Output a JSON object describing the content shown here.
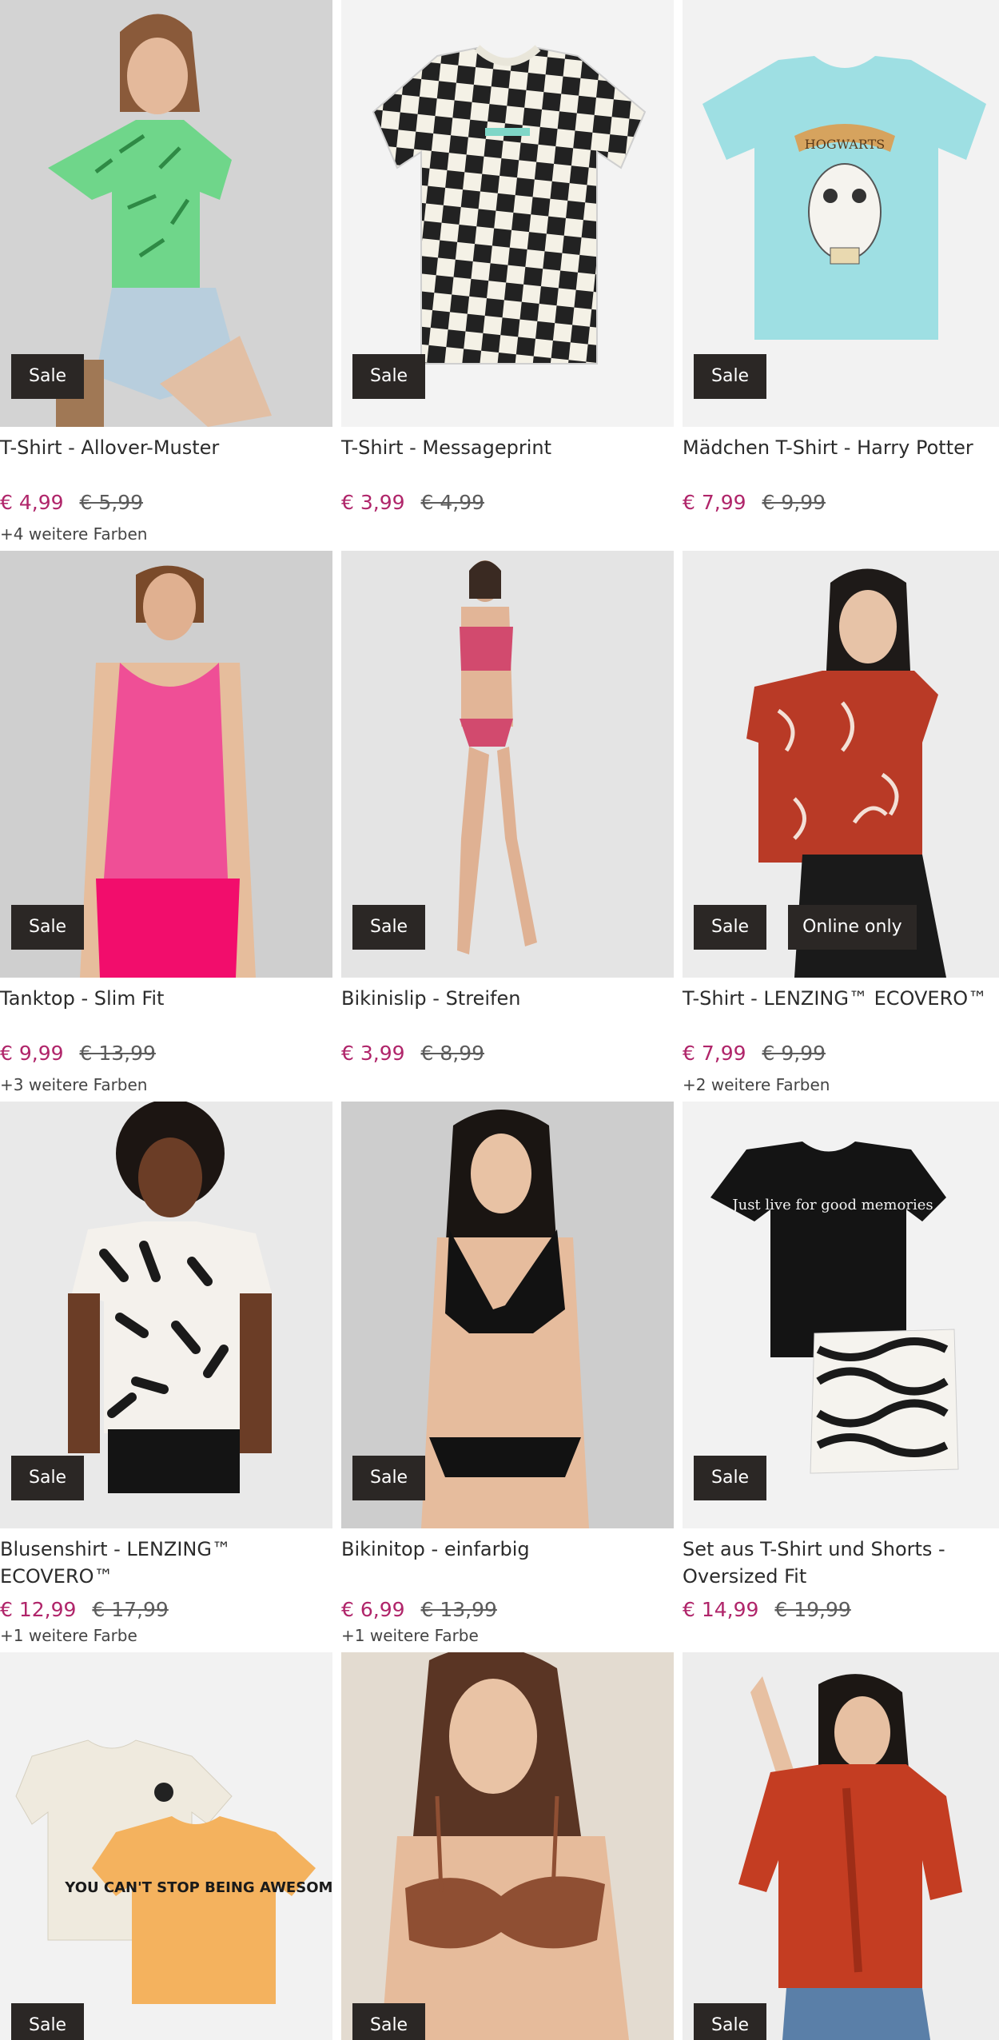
{
  "products": [
    {
      "title": "T-Shirt - Allover-Muster",
      "price_sale": "€ 4,99",
      "price_old": "€ 5,99",
      "colors": "+4 weitere Farben",
      "badge": "Sale",
      "badge2": ""
    },
    {
      "title": "T-Shirt - Messageprint",
      "price_sale": "€ 3,99",
      "price_old": "€ 4,99",
      "colors": "",
      "badge": "Sale",
      "badge2": ""
    },
    {
      "title": "Mädchen T-Shirt - Harry Potter",
      "price_sale": "€ 7,99",
      "price_old": "€ 9,99",
      "colors": "",
      "badge": "Sale",
      "badge2": ""
    },
    {
      "title": "Tanktop - Slim Fit",
      "price_sale": "€ 9,99",
      "price_old": "€ 13,99",
      "colors": "+3 weitere Farben",
      "badge": "Sale",
      "badge2": ""
    },
    {
      "title": "Bikinislip - Streifen",
      "price_sale": "€ 3,99",
      "price_old": "€ 8,99",
      "colors": "",
      "badge": "Sale",
      "badge2": ""
    },
    {
      "title": "T-Shirt - LENZING™ ECOVERO™",
      "price_sale": "€ 7,99",
      "price_old": "€ 9,99",
      "colors": "+2 weitere Farben",
      "badge": "Sale",
      "badge2": "Online only"
    },
    {
      "title": "Blusenshirt - LENZING™ ECOVERO™",
      "price_sale": "€ 12,99",
      "price_old": "€ 17,99",
      "colors": "+1 weitere Farbe",
      "badge": "Sale",
      "badge2": ""
    },
    {
      "title": "Bikinitop - einfarbig",
      "price_sale": "€ 6,99",
      "price_old": "€ 13,99",
      "colors": "+1 weitere Farbe",
      "badge": "Sale",
      "badge2": ""
    },
    {
      "title": "Set aus T-Shirt und Shorts - Oversized Fit",
      "price_sale": "€ 14,99",
      "price_old": "€ 19,99",
      "colors": "",
      "badge": "Sale",
      "badge2": ""
    },
    {
      "title": "",
      "price_sale": "",
      "price_old": "",
      "colors": "",
      "badge": "Sale",
      "badge2": ""
    },
    {
      "title": "",
      "price_sale": "",
      "price_old": "",
      "colors": "",
      "badge": "Sale",
      "badge2": ""
    },
    {
      "title": "",
      "price_sale": "",
      "price_old": "",
      "colors": "",
      "badge": "Sale",
      "badge2": ""
    }
  ],
  "print_texts": {
    "hogwarts": "HOGWARTS",
    "memories": "Just live for good memories",
    "awesome": "YOU CAN'T STOP BEING AWESOME"
  },
  "colors": {
    "sale_price": "#b0256a",
    "badge_bg": "#2b2725",
    "text": "#2b2b2b"
  }
}
